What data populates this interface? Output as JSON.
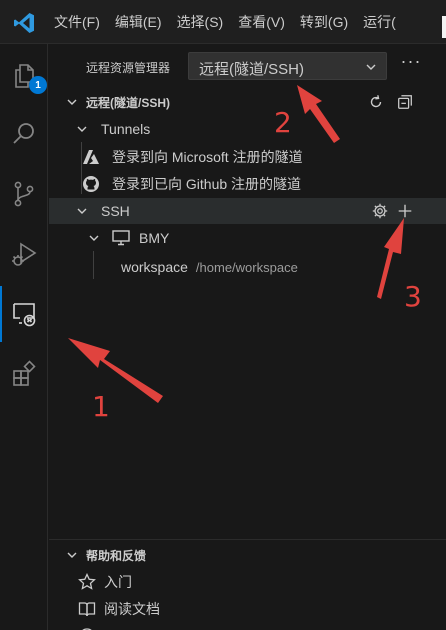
{
  "menu": [
    "文件(F)",
    "编辑(E)",
    "选择(S)",
    "查看(V)",
    "转到(G)",
    "运行("
  ],
  "activity": {
    "explorer_badge": "1"
  },
  "sidebar": {
    "title": "远程资源管理器",
    "dropdown_value": "远程(隧道/SSH)",
    "more": "···",
    "section_title": "远程(隧道/SSH)",
    "tunnels_label": "Tunnels",
    "tunnel_items": [
      {
        "label": "登录到向 Microsoft 注册的隧道",
        "icon": "azure-icon"
      },
      {
        "label": "登录到已向 Github 注册的隧道",
        "icon": "github-icon"
      }
    ],
    "ssh_label": "SSH",
    "host_label": "BMY",
    "folder_label": "workspace",
    "folder_path": "/home/workspace",
    "help_title": "帮助和反馈",
    "help_items": [
      {
        "label": "入门",
        "icon": "star-icon"
      },
      {
        "label": "阅读文档",
        "icon": "book-icon"
      }
    ]
  },
  "annotations": [
    "1",
    "2",
    "3"
  ],
  "colors": {
    "accent": "#0078d4",
    "annotation": "#e0433e",
    "background": "#181818"
  }
}
